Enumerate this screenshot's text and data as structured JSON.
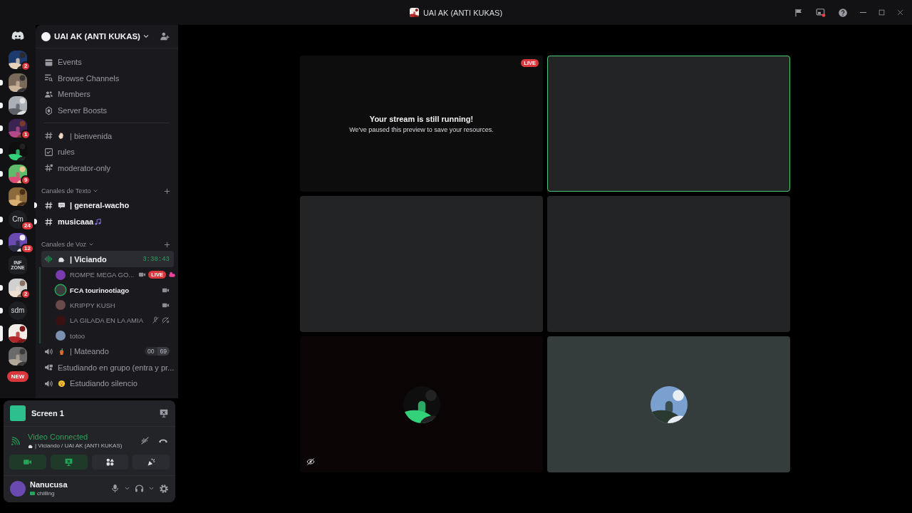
{
  "window": {
    "title": "UAI AK (ANTI KUKAS)"
  },
  "servers": [
    {
      "kind": "picture",
      "badge": "2",
      "unread": false,
      "selected": false
    },
    {
      "kind": "picture",
      "unread": true,
      "selected": false
    },
    {
      "kind": "picture",
      "unread": true,
      "selected": false
    },
    {
      "kind": "picture",
      "badge": "1",
      "unread": true,
      "selected": false
    },
    {
      "kind": "picture",
      "unread": true,
      "selected": false
    },
    {
      "kind": "picture",
      "badge": "9",
      "unread": true,
      "selected": false
    },
    {
      "kind": "picture",
      "unread": false,
      "selected": false
    },
    {
      "kind": "text",
      "label": "Cm",
      "badge": "24",
      "unread": true,
      "selected": false
    },
    {
      "kind": "picture",
      "badge": "12",
      "unread": true,
      "selected": false
    },
    {
      "kind": "text",
      "label": "INF ZONE",
      "unread": false,
      "selected": false
    },
    {
      "kind": "picture",
      "badge": "2",
      "unread": true,
      "selected": false
    },
    {
      "kind": "text",
      "label": "sdm",
      "unread": true,
      "selected": false
    },
    {
      "kind": "picture",
      "unread": false,
      "selected": true
    },
    {
      "kind": "picture",
      "unread": false,
      "selected": false
    }
  ],
  "new_pill": "NEW",
  "server": {
    "name": "UAI AK (ANTI KUKAS)"
  },
  "nav": [
    {
      "label": "Events"
    },
    {
      "label": "Browse Channels"
    },
    {
      "label": "Members"
    },
    {
      "label": "Server Boosts"
    }
  ],
  "channels": [
    {
      "name": "| bienvenida",
      "unread": false
    },
    {
      "name": "rules",
      "unread": false
    },
    {
      "name": "moderator-only",
      "unread": false
    }
  ],
  "categories": [
    {
      "name": "Canales de Texto",
      "channels": [
        {
          "kind": "text",
          "name": "| general-wacho",
          "unread": true
        },
        {
          "kind": "text",
          "name": "musicaaa",
          "unread": true
        }
      ]
    },
    {
      "name": "Canales de Voz",
      "channels": [
        {
          "kind": "voice",
          "name": "| Viciando",
          "selected": true,
          "timer": "3:38:43",
          "users": [
            {
              "name": "ROMPE MEGA GO...",
              "speaking": false,
              "video": true,
              "live": "LIVE",
              "activity": true,
              "muted": false
            },
            {
              "name": "FCA tourinootiago",
              "speaking": true,
              "video": true,
              "activity": false,
              "muted": false
            },
            {
              "name": "KRIPPY KUSH",
              "speaking": false,
              "video": true,
              "activity": false,
              "muted": false
            },
            {
              "name": "LA GILADA EN LA AMIA",
              "speaking": false,
              "video": false,
              "activity": false,
              "muted": true
            },
            {
              "name": "totoo",
              "speaking": false,
              "video": false,
              "activity": false,
              "muted": false
            }
          ]
        },
        {
          "kind": "voice",
          "name": "| Mateando",
          "selected": false,
          "counter": [
            "00",
            "69"
          ]
        },
        {
          "kind": "voice",
          "name": "Estudiando en grupo (entra y pr...",
          "selected": false
        },
        {
          "kind": "voice",
          "name": "Estudiando silencio",
          "selected": false
        }
      ]
    }
  ],
  "stream_panel": {
    "title": "Screen 1"
  },
  "voice_panel": {
    "status": "Video Connected",
    "channel": "| Viciando / UAI AK (ANTI KUKAS)",
    "buttons": [
      {
        "kind": "camera",
        "on": true
      },
      {
        "kind": "screen",
        "on": true
      },
      {
        "kind": "activities",
        "on": false
      },
      {
        "kind": "soundboard",
        "on": false
      }
    ]
  },
  "user": {
    "name": "Nanucusa",
    "status": "chilling"
  },
  "tiles": [
    {
      "kind": "stream",
      "live": "LIVE",
      "title": "Your stream is still running!",
      "subtitle": "We've paused this preview to save your resources.",
      "speaking": false,
      "preview_hidden": false
    },
    {
      "kind": "empty",
      "speaking": true,
      "preview_hidden": false
    },
    {
      "kind": "empty",
      "speaking": false,
      "preview_hidden": false
    },
    {
      "kind": "empty",
      "speaking": false,
      "preview_hidden": false
    },
    {
      "kind": "avatar",
      "speaking": false,
      "preview_hidden": true
    },
    {
      "kind": "avatar",
      "speaking": false,
      "preview_hidden": false
    }
  ]
}
